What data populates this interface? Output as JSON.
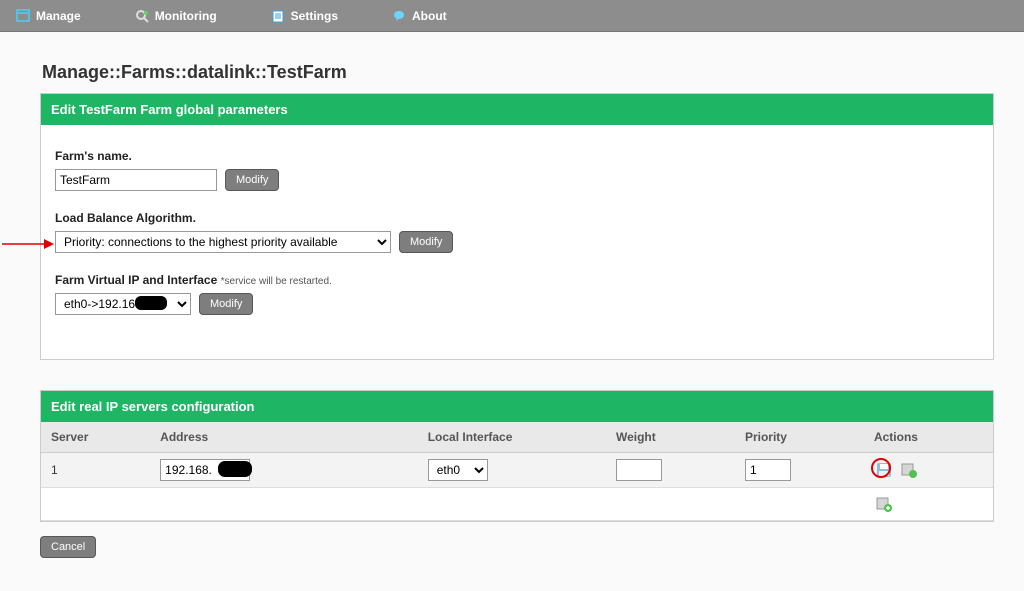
{
  "nav": {
    "manage": "Manage",
    "monitoring": "Monitoring",
    "settings": "Settings",
    "about": "About"
  },
  "breadcrumb": "Manage::Farms::datalink::TestFarm",
  "panel1": {
    "title": "Edit TestFarm Farm global parameters",
    "name_label": "Farm's name.",
    "name_value": "TestFarm",
    "modify": "Modify",
    "algo_label": "Load Balance Algorithm.",
    "algo_value": "Priority: connections to the highest priority available",
    "vip_label": "Farm Virtual IP and Interface ",
    "vip_note": "*service will be restarted.",
    "vip_value": "eth0->192.168."
  },
  "panel2": {
    "title": "Edit real IP servers configuration",
    "headers": {
      "server": "Server",
      "address": "Address",
      "local": "Local Interface",
      "weight": "Weight",
      "priority": "Priority",
      "actions": "Actions"
    },
    "row": {
      "server": "1",
      "address": "192.168.",
      "local": "eth0",
      "weight": "",
      "priority": "1"
    }
  },
  "cancel": "Cancel"
}
